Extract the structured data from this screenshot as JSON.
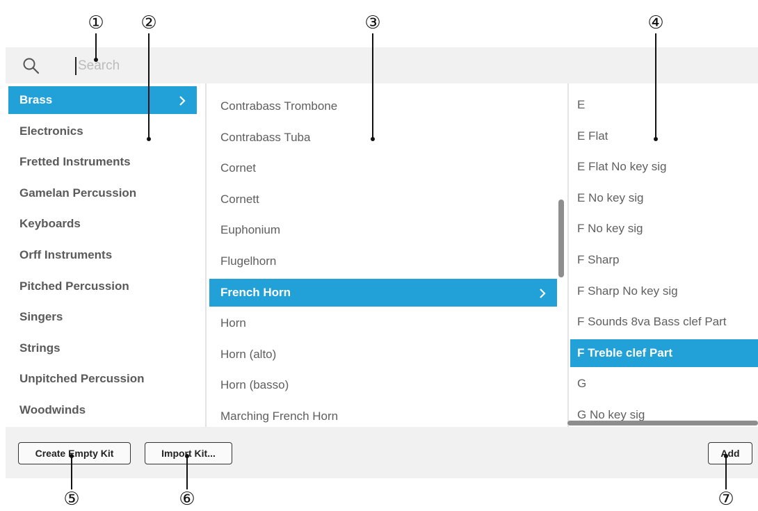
{
  "callouts": [
    "①",
    "②",
    "③",
    "④",
    "⑤",
    "⑥",
    "⑦"
  ],
  "search": {
    "placeholder": "Search",
    "icon": "search-icon"
  },
  "categories": [
    "Brass",
    "Electronics",
    "Fretted Instruments",
    "Gamelan Percussion",
    "Keyboards",
    "Orff Instruments",
    "Pitched Percussion",
    "Singers",
    "Strings",
    "Unpitched Percussion",
    "Woodwinds"
  ],
  "categories_selected": "Brass",
  "instruments": [
    "Contrabass Trombone",
    "Contrabass Tuba",
    "Cornet",
    "Cornett",
    "Euphonium",
    "Flugelhorn",
    "French Horn",
    "Horn",
    "Horn (alto)",
    "Horn (basso)",
    "Marching French Horn"
  ],
  "instruments_selected": "French Horn",
  "variants": [
    "E",
    "E Flat",
    "E Flat No key sig",
    "E No key sig",
    "F No key sig",
    "F Sharp",
    "F Sharp No key sig",
    "F Sounds 8va Bass clef Part",
    "F Treble clef Part",
    "G",
    "G No key sig"
  ],
  "variants_selected": "F Treble clef Part",
  "buttons": {
    "create_empty_kit": "Create Empty Kit",
    "import_kit": "Import Kit...",
    "add": "Add"
  },
  "colors": {
    "selection": "#22a0d8",
    "bar_background": "#f1f1f1"
  }
}
